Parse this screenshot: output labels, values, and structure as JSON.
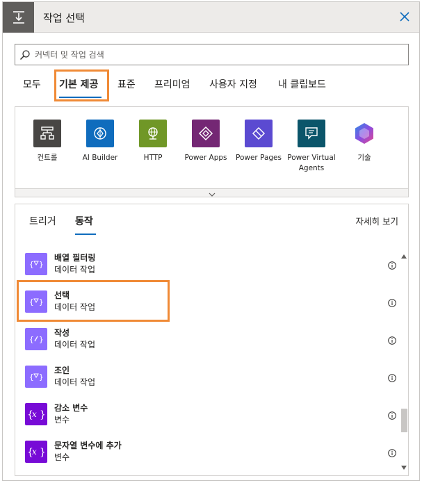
{
  "header": {
    "title": "작업 선택"
  },
  "search": {
    "placeholder": "커넥터 및 작업 검색"
  },
  "category_tabs": [
    {
      "label": "모두"
    },
    {
      "label": "기본 제공",
      "selected": true
    },
    {
      "label": "표준"
    },
    {
      "label": "프리미엄"
    },
    {
      "label": "사용자 지정"
    },
    {
      "label": "내 클립보드"
    }
  ],
  "connectors": [
    {
      "label": "컨트롤",
      "color": "#484644",
      "icon": "control-icon"
    },
    {
      "label": "AI Builder",
      "color": "#0f6cbd",
      "icon": "ai-builder-icon"
    },
    {
      "label": "HTTP",
      "color": "#709727",
      "icon": "http-globe-icon"
    },
    {
      "label": "Power Apps",
      "color": "#742774",
      "icon": "power-apps-icon"
    },
    {
      "label": "Power Pages",
      "color": "#5b4ad1",
      "icon": "power-pages-icon"
    },
    {
      "label": "Power Virtual Agents",
      "color": "#0b556a",
      "icon": "power-virtual-agents-icon"
    },
    {
      "label": "기술",
      "color": "#ffffff",
      "icon": "skills-icon"
    }
  ],
  "sub_tabs": [
    {
      "label": "트리거"
    },
    {
      "label": "동작",
      "selected": true
    }
  ],
  "details_link": "자세히 보기",
  "actions": [
    {
      "name": "배열 필터링",
      "sub": "데이터 작업",
      "color": "#8c6cff",
      "icon": "filter-array-icon"
    },
    {
      "name": "선택",
      "sub": "데이터 작업",
      "color": "#8c6cff",
      "icon": "select-icon"
    },
    {
      "name": "작성",
      "sub": "데이터 작업",
      "color": "#8c6cff",
      "icon": "compose-icon"
    },
    {
      "name": "조인",
      "sub": "데이터 작업",
      "color": "#8c6cff",
      "icon": "join-icon"
    },
    {
      "name": "감소 변수",
      "sub": "변수",
      "color": "#770bd6",
      "icon": "variable-icon"
    },
    {
      "name": "문자열 변수에 추가",
      "sub": "변수",
      "color": "#770bd6",
      "icon": "variable-icon"
    }
  ],
  "highlight_color": "#f08a36",
  "accent_color": "#0f6cbd"
}
